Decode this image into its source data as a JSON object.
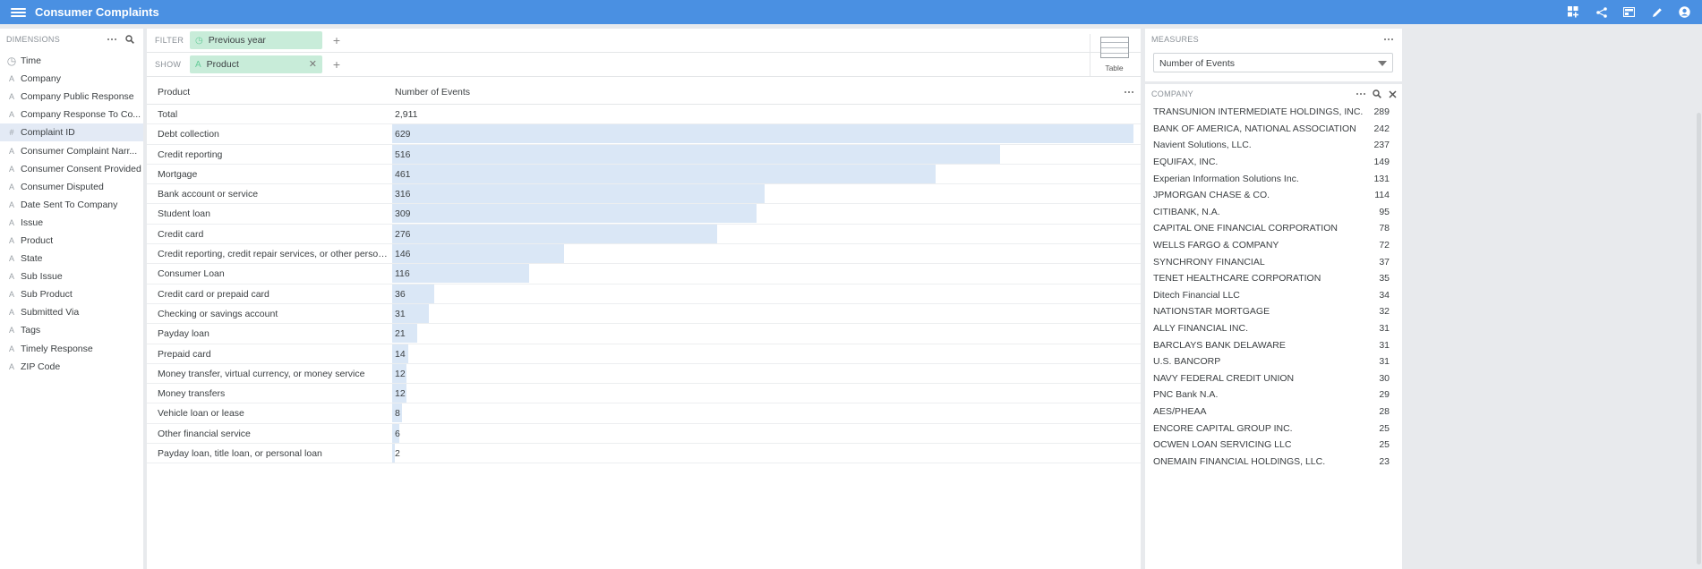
{
  "app": {
    "title": "Consumer Complaints"
  },
  "dimensions": {
    "header": "DIMENSIONS",
    "items": [
      {
        "label": "Time",
        "icon": "clock-icon"
      },
      {
        "label": "Company",
        "icon": "text-type-icon"
      },
      {
        "label": "Company Public Response",
        "icon": "text-type-icon"
      },
      {
        "label": "Company Response To Co...",
        "icon": "text-type-icon"
      },
      {
        "label": "Complaint ID",
        "icon": "hash-icon",
        "selected": true
      },
      {
        "label": "Consumer Complaint Narr...",
        "icon": "text-type-icon"
      },
      {
        "label": "Consumer Consent Provided",
        "icon": "text-type-icon"
      },
      {
        "label": "Consumer Disputed",
        "icon": "text-type-icon"
      },
      {
        "label": "Date Sent To Company",
        "icon": "text-type-icon"
      },
      {
        "label": "Issue",
        "icon": "text-type-icon"
      },
      {
        "label": "Product",
        "icon": "text-type-icon"
      },
      {
        "label": "State",
        "icon": "text-type-icon"
      },
      {
        "label": "Sub Issue",
        "icon": "text-type-icon"
      },
      {
        "label": "Sub Product",
        "icon": "text-type-icon"
      },
      {
        "label": "Submitted Via",
        "icon": "text-type-icon"
      },
      {
        "label": "Tags",
        "icon": "text-type-icon"
      },
      {
        "label": "Timely Response",
        "icon": "text-type-icon"
      },
      {
        "label": "ZIP Code",
        "icon": "text-type-icon"
      }
    ]
  },
  "filter": {
    "label": "FILTER",
    "pill": "Previous year"
  },
  "show": {
    "label": "SHOW",
    "pill": "Product"
  },
  "viz": {
    "label": "Table"
  },
  "table": {
    "col1": "Product",
    "col2": "Number of Events",
    "total_label": "Total",
    "total_value": "2,911",
    "max": 629,
    "rows": [
      {
        "name": "Debt collection",
        "value": 629
      },
      {
        "name": "Credit reporting",
        "value": 516
      },
      {
        "name": "Mortgage",
        "value": 461
      },
      {
        "name": "Bank account or service",
        "value": 316
      },
      {
        "name": "Student loan",
        "value": 309
      },
      {
        "name": "Credit card",
        "value": 276
      },
      {
        "name": "Credit reporting, credit repair services, or other personal consumer reports",
        "value": 146
      },
      {
        "name": "Consumer Loan",
        "value": 116
      },
      {
        "name": "Credit card or prepaid card",
        "value": 36
      },
      {
        "name": "Checking or savings account",
        "value": 31
      },
      {
        "name": "Payday loan",
        "value": 21
      },
      {
        "name": "Prepaid card",
        "value": 14
      },
      {
        "name": "Money transfer, virtual currency, or money service",
        "value": 12
      },
      {
        "name": "Money transfers",
        "value": 12
      },
      {
        "name": "Vehicle loan or lease",
        "value": 8
      },
      {
        "name": "Other financial service",
        "value": 6
      },
      {
        "name": "Payday loan, title loan, or personal loan",
        "value": 2
      }
    ]
  },
  "measures": {
    "header": "MEASURES",
    "selected": "Number of Events"
  },
  "company": {
    "header": "COMPANY",
    "items": [
      {
        "name": "TRANSUNION INTERMEDIATE HOLDINGS, INC.",
        "count": "289"
      },
      {
        "name": "BANK OF AMERICA, NATIONAL ASSOCIATION",
        "count": "242"
      },
      {
        "name": "Navient Solutions, LLC.",
        "count": "237"
      },
      {
        "name": "EQUIFAX, INC.",
        "count": "149"
      },
      {
        "name": "Experian Information Solutions Inc.",
        "count": "131"
      },
      {
        "name": "JPMORGAN CHASE & CO.",
        "count": "114"
      },
      {
        "name": "CITIBANK, N.A.",
        "count": "95"
      },
      {
        "name": "CAPITAL ONE FINANCIAL CORPORATION",
        "count": "78"
      },
      {
        "name": "WELLS FARGO & COMPANY",
        "count": "72"
      },
      {
        "name": "SYNCHRONY FINANCIAL",
        "count": "37"
      },
      {
        "name": "TENET HEALTHCARE CORPORATION",
        "count": "35"
      },
      {
        "name": "Ditech Financial LLC",
        "count": "34"
      },
      {
        "name": "NATIONSTAR MORTGAGE",
        "count": "32"
      },
      {
        "name": "ALLY FINANCIAL INC.",
        "count": "31"
      },
      {
        "name": "BARCLAYS BANK DELAWARE",
        "count": "31"
      },
      {
        "name": "U.S. BANCORP",
        "count": "31"
      },
      {
        "name": "NAVY FEDERAL CREDIT UNION",
        "count": "30"
      },
      {
        "name": "PNC Bank N.A.",
        "count": "29"
      },
      {
        "name": "AES/PHEAA",
        "count": "28"
      },
      {
        "name": "ENCORE CAPITAL GROUP INC.",
        "count": "25"
      },
      {
        "name": "OCWEN LOAN SERVICING LLC",
        "count": "25"
      },
      {
        "name": "ONEMAIN FINANCIAL HOLDINGS, LLC.",
        "count": "23"
      }
    ]
  },
  "colors": {
    "topbar": "#4a90e2",
    "pill": "#c8ecd9",
    "bar": "#dae7f6",
    "selected_row": "#e3eaf5"
  }
}
